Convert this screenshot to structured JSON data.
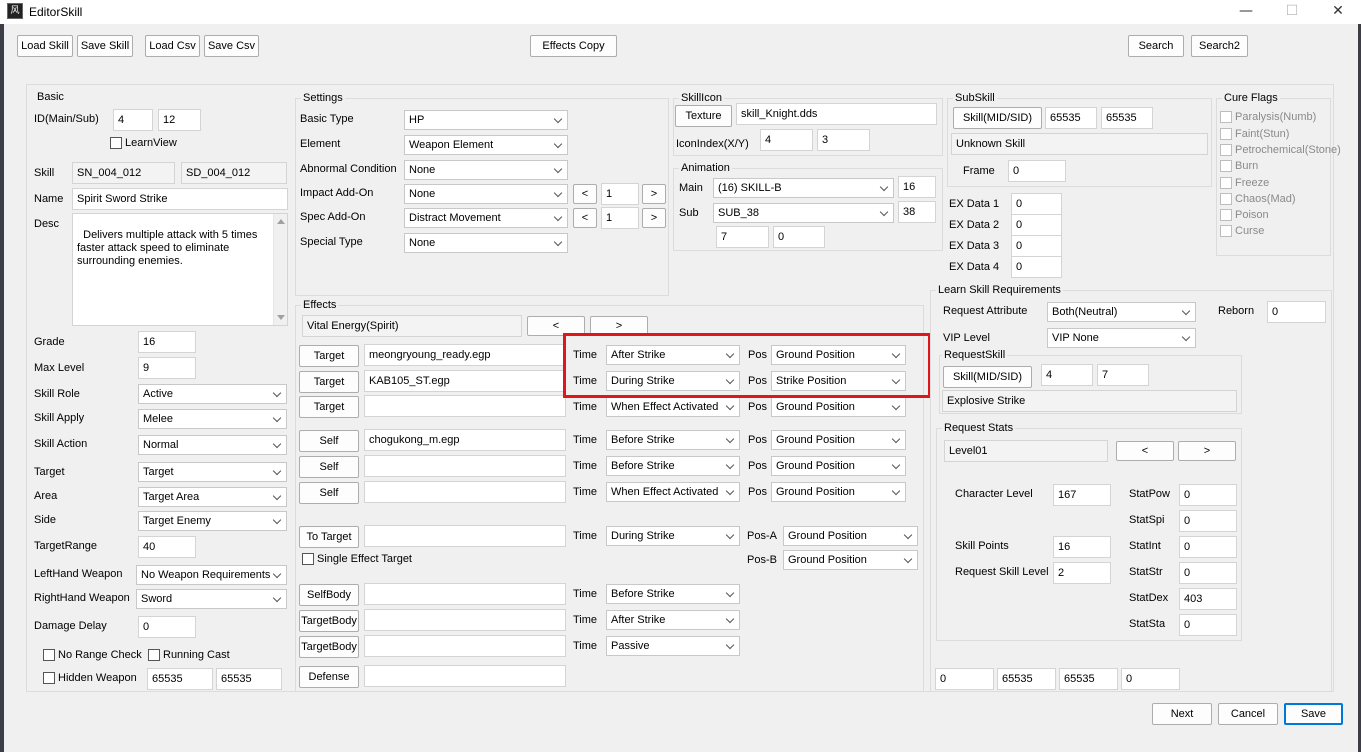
{
  "window": {
    "title": "EditorSkill",
    "min": "—",
    "max": "☐",
    "close": "✕",
    "icon": "app-icon"
  },
  "toolbar": {
    "load_skill": "Load Skill",
    "save_skill": "Save Skill",
    "load_csv": "Load Csv",
    "save_csv": "Save Csv",
    "effects_copy": "Effects Copy",
    "search": "Search",
    "search2": "Search2"
  },
  "basic": {
    "title": "Basic",
    "id_label": "ID(Main/Sub)",
    "id_main": "4",
    "id_sub": "12",
    "learn_view": "LearnView",
    "skill_label": "Skill",
    "skill_sn": "SN_004_012",
    "skill_sd": "SD_004_012",
    "name_label": "Name",
    "name": "Spirit Sword Strike",
    "desc_label": "Desc",
    "desc": "Delivers multiple attack with 5 times\nfaster attack speed to eliminate\nsurrounding enemies.",
    "grade_label": "Grade",
    "grade": "16",
    "max_level_label": "Max Level",
    "max_level": "9",
    "skill_role_label": "Skill Role",
    "skill_role": "Active",
    "skill_apply_label": "Skill Apply",
    "skill_apply": "Melee",
    "skill_action_label": "Skill Action",
    "skill_action": "Normal",
    "target_label": "Target",
    "target": "Target",
    "area_label": "Area",
    "area": "Target Area",
    "side_label": "Side",
    "side": "Target Enemy",
    "range_label": "TargetRange",
    "range": "40",
    "lefthand_label": "LeftHand Weapon",
    "lefthand": "No Weapon Requirements",
    "righthand_label": "RightHand Weapon",
    "righthand": "Sword",
    "delay_label": "Damage Delay",
    "delay": "0",
    "no_range": "No Range Check",
    "running_cast": "Running Cast",
    "hidden_weapon": "Hidden Weapon",
    "hw1": "65535",
    "hw2": "65535"
  },
  "settings": {
    "title": "Settings",
    "basic_type_label": "Basic Type",
    "basic_type": "HP",
    "element_label": "Element",
    "element": "Weapon Element",
    "abnormal_label": "Abnormal Condition",
    "abnormal": "None",
    "impact_label": "Impact Add-On",
    "impact": "None",
    "impact_val": "1",
    "spec_label": "Spec Add-On",
    "spec": "Distract Movement",
    "spec_val": "1",
    "special_label": "Special Type",
    "special": "None",
    "prev": "<",
    "next": ">"
  },
  "skillicon": {
    "title": "SkillIcon",
    "texture_btn": "Texture",
    "texture": "skill_Knight.dds",
    "index_label": "IconIndex(X/Y)",
    "x": "4",
    "y": "3"
  },
  "animation": {
    "title": "Animation",
    "main_label": "Main",
    "main": "(16) SKILL-B",
    "main_val": "16",
    "sub_label": "Sub",
    "sub": "SUB_38",
    "sub_val": "38",
    "v1": "7",
    "v2": "0"
  },
  "subskill": {
    "title": "SubSkill",
    "btn": "Skill(MID/SID)",
    "mid": "65535",
    "sid": "65535",
    "name": "Unknown Skill",
    "frame_label": "Frame",
    "frame": "0",
    "ex": [
      {
        "label": "EX Data 1",
        "value": "0"
      },
      {
        "label": "EX Data 2",
        "value": "0"
      },
      {
        "label": "EX Data 3",
        "value": "0"
      },
      {
        "label": "EX Data 4",
        "value": "0"
      }
    ]
  },
  "cure": {
    "title": "Cure Flags",
    "items": [
      "Paralysis(Numb)",
      "Faint(Stun)",
      "Petrochemical(Stone)",
      "Burn",
      "Freeze",
      "Chaos(Mad)",
      "Poison",
      "Curse"
    ]
  },
  "effects": {
    "title": "Effects",
    "vital": "Vital Energy(Spirit)",
    "prev": "<",
    "next": ">",
    "time_label": "Time",
    "pos_label": "Pos",
    "pos_a_label": "Pos-A",
    "pos_b_label": "Pos-B",
    "single_target": "Single Effect Target",
    "rows": [
      {
        "btn": "Target",
        "file": "meongryoung_ready.egp",
        "time": "After Strike",
        "pos": "Ground Position"
      },
      {
        "btn": "Target",
        "file": "KAB105_ST.egp",
        "time": "During Strike",
        "pos": "Strike Position"
      },
      {
        "btn": "Target",
        "file": "",
        "time": "When Effect Activated",
        "pos": "Ground Position"
      },
      {
        "btn": "Self",
        "file": "chogukong_m.egp",
        "time": "Before Strike",
        "pos": "Ground Position"
      },
      {
        "btn": "Self",
        "file": "",
        "time": "Before Strike",
        "pos": "Ground Position"
      },
      {
        "btn": "Self",
        "file": "",
        "time": "When Effect Activated",
        "pos": "Ground Position"
      }
    ],
    "to_target": {
      "btn": "To Target",
      "file": "",
      "time": "During Strike",
      "pos_a": "Ground Position",
      "pos_b": "Ground Position"
    },
    "body": [
      {
        "btn": "SelfBody",
        "file": "",
        "time": "Before Strike"
      },
      {
        "btn": "TargetBody",
        "file": "",
        "time": "After Strike"
      },
      {
        "btn": "TargetBody",
        "file": "",
        "time": "Passive"
      }
    ],
    "defense": {
      "btn": "Defense",
      "file": ""
    }
  },
  "learn": {
    "title": "Learn Skill Requirements",
    "attr_label": "Request Attribute",
    "attr": "Both(Neutral)",
    "reborn_label": "Reborn",
    "reborn": "0",
    "vip_label": "VIP Level",
    "vip": "VIP None",
    "request_skill": {
      "title": "RequestSkill",
      "btn": "Skill(MID/SID)",
      "mid": "4",
      "sid": "7",
      "name": "Explosive Strike"
    },
    "stats": {
      "title": "Request Stats",
      "level": "Level01",
      "prev": "<",
      "next": ">",
      "char_level_label": "Character Level",
      "char_level": "167",
      "skill_points_label": "Skill Points",
      "skill_points": "16",
      "req_skill_level_label": "Request Skill Level",
      "req_skill_level": "2",
      "stat": [
        {
          "label": "StatPow",
          "value": "0"
        },
        {
          "label": "StatSpi",
          "value": "0"
        },
        {
          "label": "StatInt",
          "value": "0"
        },
        {
          "label": "StatStr",
          "value": "0"
        },
        {
          "label": "StatDex",
          "value": "403"
        },
        {
          "label": "StatSta",
          "value": "0"
        }
      ]
    },
    "bottom": [
      "0",
      "65535",
      "65535",
      "0"
    ]
  },
  "footer": {
    "next": "Next",
    "cancel": "Cancel",
    "save": "Save"
  },
  "colors": {
    "highlight": "#e0161b",
    "primary_border": "#0078d7",
    "background": "#f0f0f0"
  }
}
